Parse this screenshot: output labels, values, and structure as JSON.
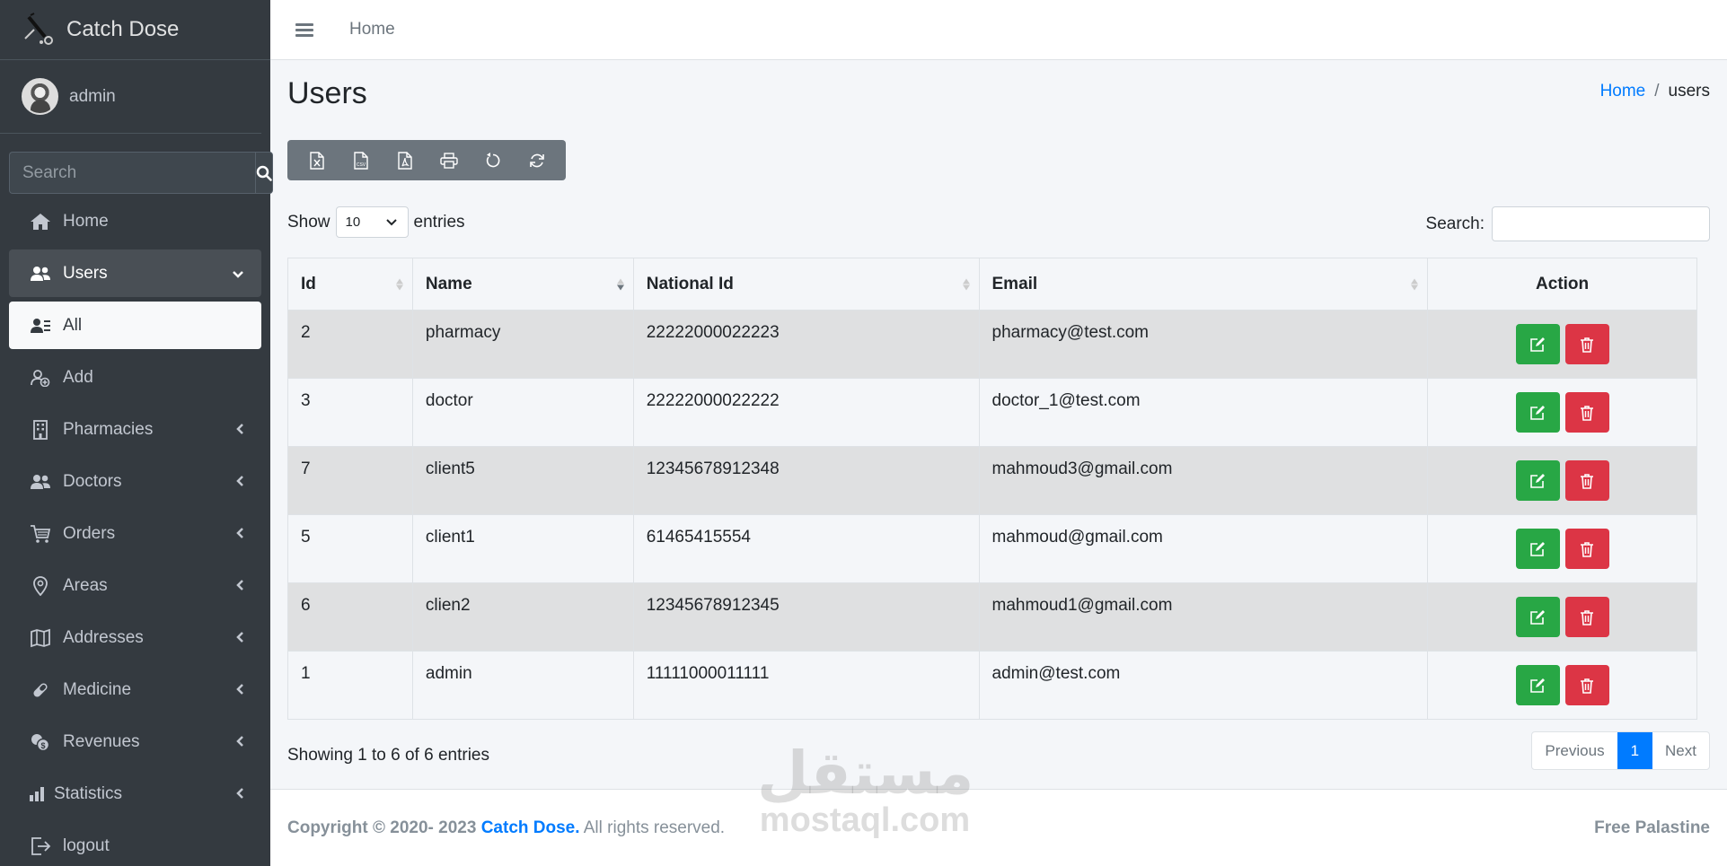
{
  "brand": {
    "name": "Catch Dose"
  },
  "user": {
    "name": "admin"
  },
  "sidebar_search": {
    "placeholder": "Search"
  },
  "nav": [
    {
      "label": "Home",
      "icon": "home-icon",
      "state": "normal",
      "chevron": false
    },
    {
      "label": "Users",
      "icon": "users-icon",
      "state": "open",
      "chevron": "down"
    },
    {
      "label": "All",
      "icon": "user-list-icon",
      "state": "active",
      "chevron": false
    },
    {
      "label": "Add",
      "icon": "user-add-icon",
      "state": "normal",
      "chevron": false
    },
    {
      "label": "Pharmacies",
      "icon": "building-icon",
      "state": "normal",
      "chevron": "left"
    },
    {
      "label": "Doctors",
      "icon": "users-icon",
      "state": "normal",
      "chevron": "left"
    },
    {
      "label": "Orders",
      "icon": "cart-icon",
      "state": "normal",
      "chevron": "left"
    },
    {
      "label": "Areas",
      "icon": "map-pin-icon",
      "state": "normal",
      "chevron": "left"
    },
    {
      "label": "Addresses",
      "icon": "map-icon",
      "state": "normal",
      "chevron": "left"
    },
    {
      "label": "Medicine",
      "icon": "pill-icon",
      "state": "normal",
      "chevron": "left"
    },
    {
      "label": "Revenues",
      "icon": "coins-icon",
      "state": "normal",
      "chevron": "left"
    },
    {
      "label": "Statistics",
      "icon": "bar-chart-icon",
      "state": "normal",
      "chevron": "left"
    },
    {
      "label": "logout",
      "icon": "logout-icon",
      "state": "normal",
      "chevron": false
    }
  ],
  "header": {
    "home": "Home"
  },
  "page": {
    "title": "Users"
  },
  "breadcrumb": {
    "home": "Home",
    "sep": "/",
    "current": "users"
  },
  "toolbar": [
    "excel-icon",
    "csv-icon",
    "pdf-icon",
    "print-icon",
    "reset-icon",
    "reload-icon"
  ],
  "length": {
    "show": "Show",
    "value": "10",
    "entries": "entries"
  },
  "dt_search": {
    "label": "Search:"
  },
  "table": {
    "columns": [
      "Id",
      "Name",
      "National Id",
      "Email",
      "Action"
    ],
    "rows": [
      {
        "id": "2",
        "name": "pharmacy",
        "national_id": "22222000022223",
        "email": "pharmacy@test.com"
      },
      {
        "id": "3",
        "name": "doctor",
        "national_id": "22222000022222",
        "email": "doctor_1@test.com"
      },
      {
        "id": "7",
        "name": "client5",
        "national_id": "12345678912348",
        "email": "mahmoud3@gmail.com"
      },
      {
        "id": "5",
        "name": "client1",
        "national_id": "61465415554",
        "email": "mahmoud@gmail.com"
      },
      {
        "id": "6",
        "name": "clien2",
        "national_id": "12345678912345",
        "email": "mahmoud1@gmail.com"
      },
      {
        "id": "1",
        "name": "admin",
        "national_id": "11111000011111",
        "email": "admin@test.com"
      }
    ]
  },
  "info": "Showing 1 to 6 of 6 entries",
  "pager": {
    "prev": "Previous",
    "page": "1",
    "next": "Next"
  },
  "footer": {
    "copyright": "Copyright © 2020- 2023",
    "brand": "Catch Dose.",
    "rights": "All rights reserved.",
    "right": "Free Palastine"
  },
  "watermark": {
    "arabic": "مستقل",
    "domain": "mostaql.com"
  },
  "colors": {
    "sidebar": "#343a40",
    "primary": "#007bff",
    "success": "#28a745",
    "danger": "#dc3545",
    "toolbar": "#6c757d"
  }
}
